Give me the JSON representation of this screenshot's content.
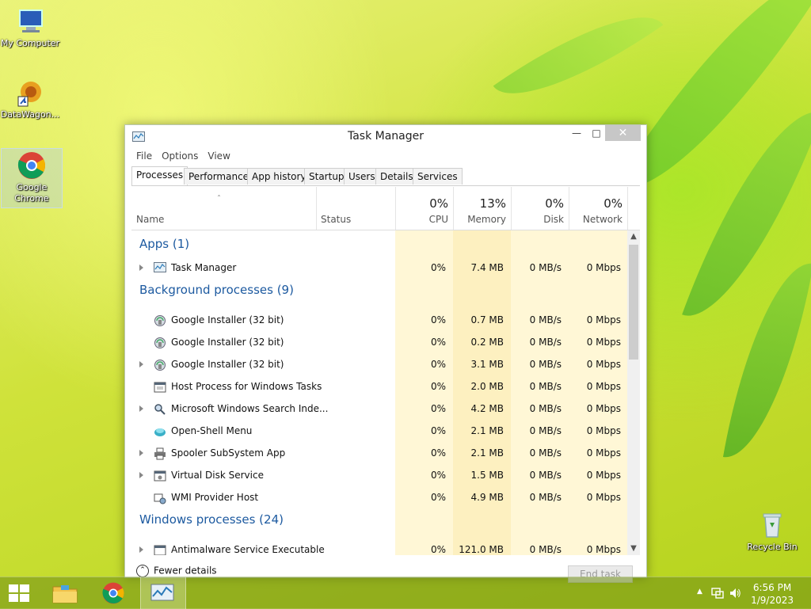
{
  "desktop": {
    "icons": [
      {
        "label": "My Computer"
      },
      {
        "label": "DataWagon..."
      },
      {
        "label": "Google Chrome"
      },
      {
        "label": "Recycle Bin"
      }
    ]
  },
  "window": {
    "title": "Task Manager",
    "menu": [
      "File",
      "Options",
      "View"
    ],
    "tabs": [
      "Processes",
      "Performance",
      "App history",
      "Startup",
      "Users",
      "Details",
      "Services"
    ],
    "active_tab": "Processes",
    "columns": {
      "name": "Name",
      "status": "Status",
      "cpu": {
        "pct": "0%",
        "label": "CPU"
      },
      "memory": {
        "pct": "13%",
        "label": "Memory"
      },
      "disk": {
        "pct": "0%",
        "label": "Disk"
      },
      "network": {
        "pct": "0%",
        "label": "Network"
      }
    },
    "groups": {
      "apps": "Apps (1)",
      "background": "Background processes (9)",
      "windows": "Windows processes (24)"
    },
    "apps": [
      {
        "name": "Task Manager",
        "cpu": "0%",
        "memory": "7.4 MB",
        "disk": "0 MB/s",
        "network": "0 Mbps",
        "icon": "task-manager-icon"
      }
    ],
    "background": [
      {
        "name": "Google Installer (32 bit)",
        "cpu": "0%",
        "memory": "0.7 MB",
        "disk": "0 MB/s",
        "network": "0 Mbps",
        "icon": "installer-icon"
      },
      {
        "name": "Google Installer (32 bit)",
        "cpu": "0%",
        "memory": "0.2 MB",
        "disk": "0 MB/s",
        "network": "0 Mbps",
        "icon": "installer-icon"
      },
      {
        "name": "Google Installer (32 bit)",
        "cpu": "0%",
        "memory": "3.1 MB",
        "disk": "0 MB/s",
        "network": "0 Mbps",
        "icon": "installer-icon"
      },
      {
        "name": "Host Process for Windows Tasks",
        "cpu": "0%",
        "memory": "2.0 MB",
        "disk": "0 MB/s",
        "network": "0 Mbps",
        "icon": "host-process-icon"
      },
      {
        "name": "Microsoft Windows Search Inde...",
        "cpu": "0%",
        "memory": "4.2 MB",
        "disk": "0 MB/s",
        "network": "0 Mbps",
        "icon": "search-indexer-icon"
      },
      {
        "name": "Open-Shell Menu",
        "cpu": "0%",
        "memory": "2.1 MB",
        "disk": "0 MB/s",
        "network": "0 Mbps",
        "icon": "open-shell-icon"
      },
      {
        "name": "Spooler SubSystem App",
        "cpu": "0%",
        "memory": "2.1 MB",
        "disk": "0 MB/s",
        "network": "0 Mbps",
        "icon": "printer-icon"
      },
      {
        "name": "Virtual Disk Service",
        "cpu": "0%",
        "memory": "1.5 MB",
        "disk": "0 MB/s",
        "network": "0 Mbps",
        "icon": "service-icon"
      },
      {
        "name": "WMI Provider Host",
        "cpu": "0%",
        "memory": "4.9 MB",
        "disk": "0 MB/s",
        "network": "0 Mbps",
        "icon": "wmi-icon"
      }
    ],
    "windows": [
      {
        "name": "Antimalware Service Executable",
        "cpu": "0%",
        "memory": "121.0 MB",
        "disk": "0 MB/s",
        "network": "0 Mbps",
        "icon": "antimalware-icon"
      }
    ],
    "footer": {
      "fewer_details": "Fewer details",
      "end_task": "End task"
    }
  },
  "taskbar": {
    "time": "6:56 PM",
    "date": "1/9/2023"
  },
  "colors": {
    "group_header": "#1d5aa0",
    "heat_light": "#fff7d6",
    "heat_med": "#fdf0c0"
  }
}
